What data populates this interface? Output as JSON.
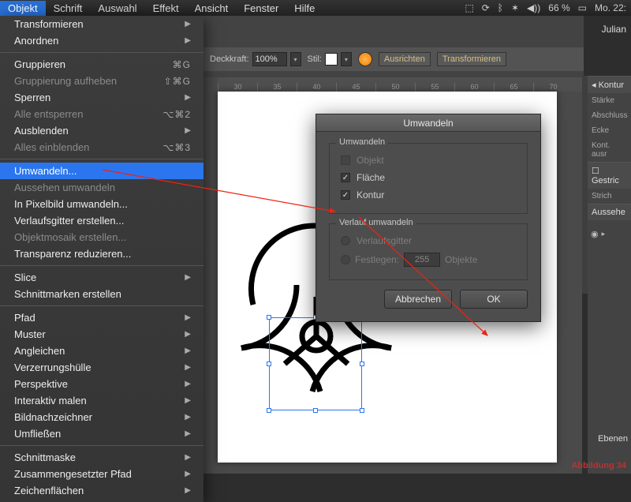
{
  "menubar": {
    "items": [
      "Objekt",
      "Schrift",
      "Auswahl",
      "Effekt",
      "Ansicht",
      "Fenster",
      "Hilfe"
    ],
    "status": {
      "battery": "66 %",
      "time": "Mo. 22:"
    }
  },
  "username": "Julian",
  "dropdown": {
    "rows": [
      {
        "label": "Transformieren",
        "type": "sub"
      },
      {
        "label": "Anordnen",
        "type": "sub"
      },
      {
        "type": "sep"
      },
      {
        "label": "Gruppieren",
        "shortcut": "⌘G"
      },
      {
        "label": "Gruppierung aufheben",
        "shortcut": "⇧⌘G",
        "disabled": true
      },
      {
        "label": "Sperren",
        "type": "sub"
      },
      {
        "label": "Alle entsperren",
        "shortcut": "⌥⌘2",
        "disabled": true
      },
      {
        "label": "Ausblenden",
        "type": "sub"
      },
      {
        "label": "Alles einblenden",
        "shortcut": "⌥⌘3",
        "disabled": true
      },
      {
        "type": "sep"
      },
      {
        "label": "Umwandeln...",
        "highlight": true
      },
      {
        "label": "Aussehen umwandeln",
        "disabled": true
      },
      {
        "label": "In Pixelbild umwandeln..."
      },
      {
        "label": "Verlaufsgitter erstellen..."
      },
      {
        "label": "Objektmosaik erstellen...",
        "disabled": true
      },
      {
        "label": "Transparenz reduzieren..."
      },
      {
        "type": "sep"
      },
      {
        "label": "Slice",
        "type": "sub"
      },
      {
        "label": "Schnittmarken erstellen"
      },
      {
        "type": "sep"
      },
      {
        "label": "Pfad",
        "type": "sub"
      },
      {
        "label": "Muster",
        "type": "sub"
      },
      {
        "label": "Angleichen",
        "type": "sub"
      },
      {
        "label": "Verzerrungshülle",
        "type": "sub"
      },
      {
        "label": "Perspektive",
        "type": "sub"
      },
      {
        "label": "Interaktiv malen",
        "type": "sub"
      },
      {
        "label": "Bildnachzeichner",
        "type": "sub"
      },
      {
        "label": "Umfließen",
        "type": "sub"
      },
      {
        "type": "sep"
      },
      {
        "label": "Schnittmaske",
        "type": "sub"
      },
      {
        "label": "Zusammengesetzter Pfad",
        "type": "sub"
      },
      {
        "label": "Zeichenflächen",
        "type": "sub"
      }
    ]
  },
  "optbar": {
    "opacity_label": "Deckkraft:",
    "opacity_value": "100%",
    "style_label": "Stil:",
    "align": "Ausrichten",
    "transform": "Transformieren"
  },
  "ruler": [
    "30",
    "35",
    "40",
    "45",
    "50",
    "55",
    "60",
    "65",
    "70"
  ],
  "dialog": {
    "title": "Umwandeln",
    "group1": {
      "label": "Umwandeln",
      "objekt": "Objekt",
      "flaeche": "Fläche",
      "kontur": "Kontur"
    },
    "group2": {
      "label": "Verlauf umwandeln",
      "gitter": "Verlaufsgitter",
      "festlegen": "Festlegen:",
      "festcount": "255",
      "objekte": "Objekte"
    },
    "cancel": "Abbrechen",
    "ok": "OK"
  },
  "rightpanel": {
    "kontur": "Kontur",
    "staerke": "Stärke",
    "abschluss": "Abschluss",
    "ecken": "Ecke",
    "kontausr": "Kont. ausr",
    "gestric": "Gestric",
    "strich": "Strich",
    "aussehen": "Aussehe"
  },
  "ebenen": "Ebenen",
  "abbild": "Abbildung 34"
}
